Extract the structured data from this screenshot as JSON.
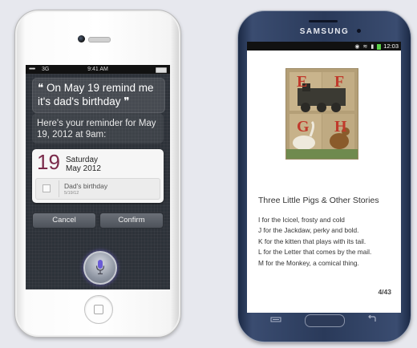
{
  "iphone": {
    "status": {
      "carrier_bars": "•••••",
      "network": "3G",
      "time": "9:41 AM"
    },
    "siri": {
      "user_utterance": "❝ On May 19 remind me it's dad's birthday ❞",
      "reply": "Here's your reminder for May 19, 2012 at 9am:",
      "reminder": {
        "day_number": "19",
        "weekday": "Saturday",
        "month_year": "May 2012",
        "title": "Dad's birthday",
        "date": "5/19/12"
      },
      "cancel_label": "Cancel",
      "confirm_label": "Confirm"
    },
    "icons": [
      "camera-icon",
      "mic-icon",
      "home-icon"
    ]
  },
  "samsung": {
    "brand": "SAMSUNG",
    "status": {
      "time": "12:03"
    },
    "book": {
      "cover_letters": [
        "E",
        "F",
        "G",
        "H"
      ],
      "title": "Three Little Pigs & Other Stories",
      "lines": [
        "I for the Icicel, frosty and cold",
        "J for the Jackdaw, perky and bold.",
        "K for the kitten that plays with its tail.",
        "L for the Letter that comes by the mail.",
        "M for the Monkey, a comical thing."
      ],
      "page_indicator": "4/43"
    },
    "colors": {
      "battery": "#5bd24a",
      "body": "#2a3a5a"
    }
  },
  "colors": {
    "background": "#e7e8ee",
    "reminder_day": "#7a2a4a"
  }
}
